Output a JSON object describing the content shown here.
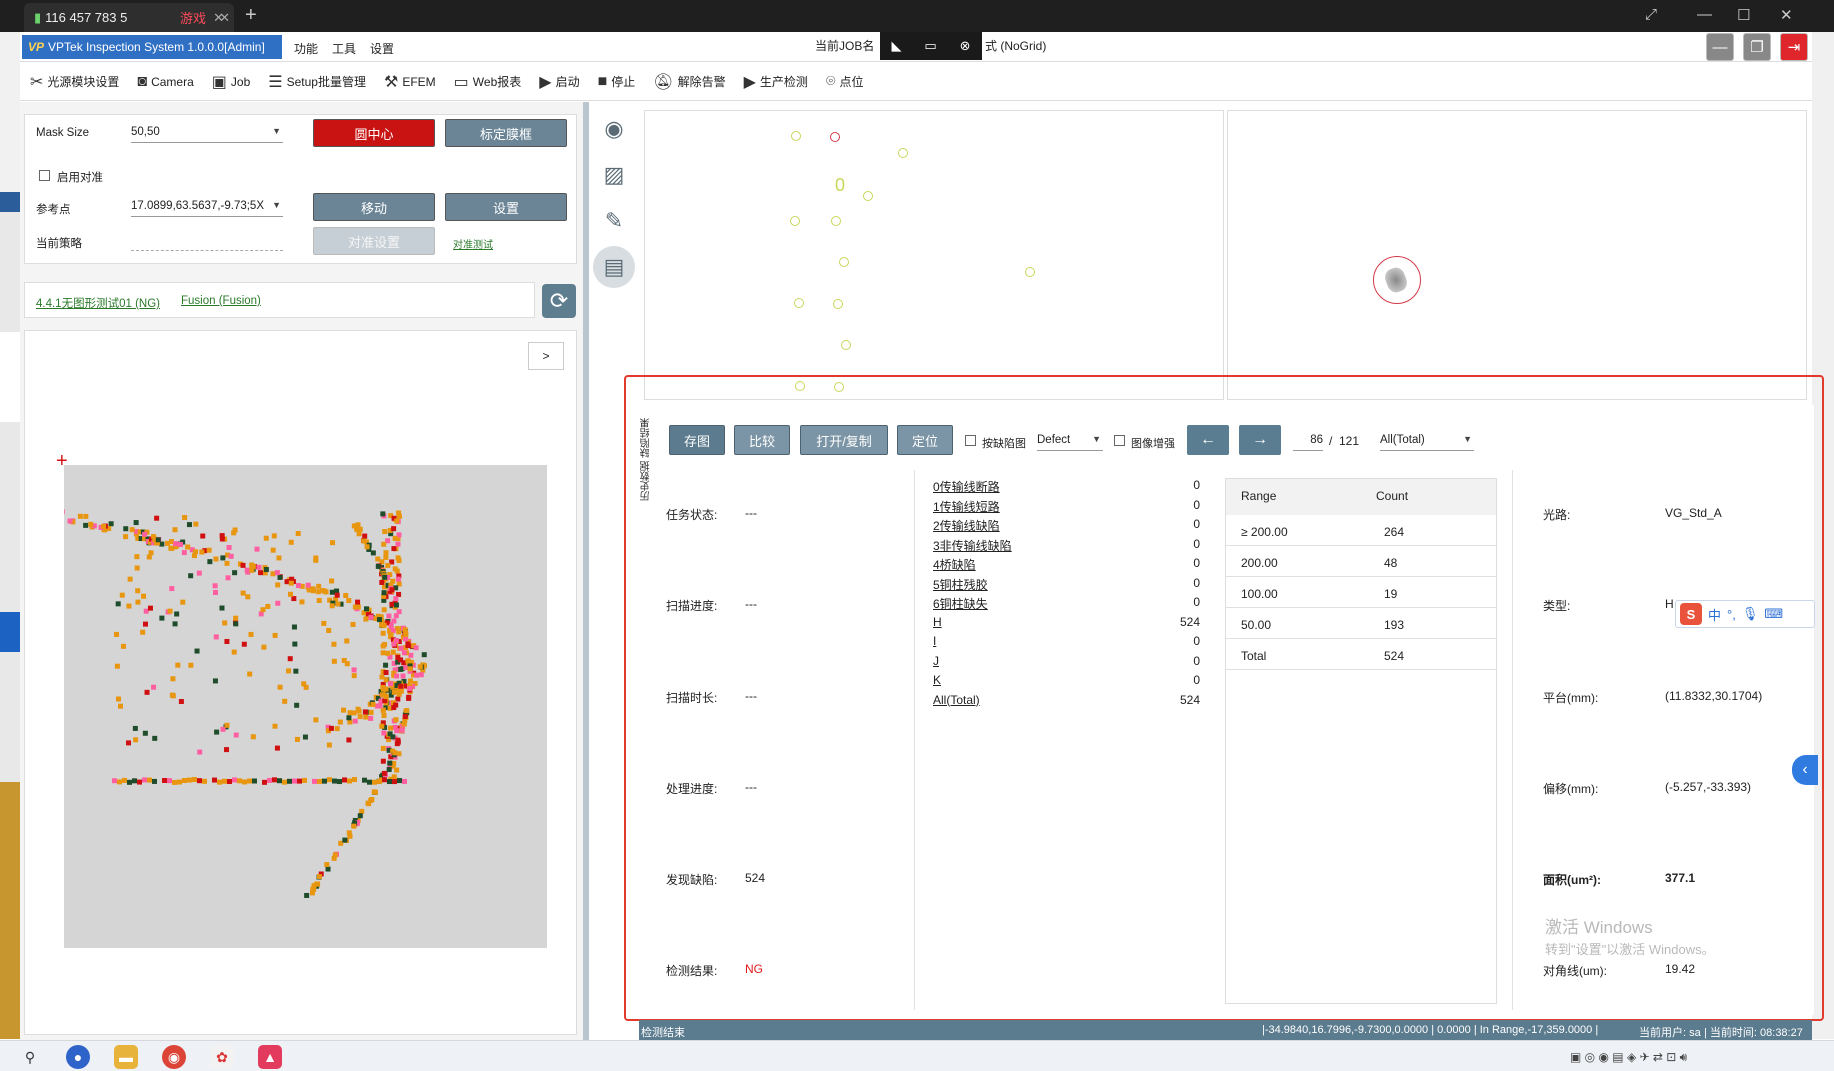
{
  "browser": {
    "tab1_title": "116 457 783 5",
    "tab2_title": "游戏",
    "close": "✕",
    "new_tab": "+"
  },
  "app": {
    "title": "VPTek Inspection System 1.0.0.0[Admin]",
    "logo": "VP",
    "menu": [
      "功能",
      "工具",
      "设置"
    ],
    "job_info_left": "当前JOB名",
    "job_info_right": "式 (NoGrid)"
  },
  "toolbar": {
    "items": [
      "光源模块设置",
      "Camera",
      "Job",
      "Setup批量管理",
      "EFEM",
      "Web报表",
      "启动",
      "停止",
      "解除告警",
      "生产检测",
      "点位"
    ]
  },
  "left": {
    "mask_size_label": "Mask Size",
    "mask_size_value": "50,50",
    "circle_center_btn": "圆中心",
    "calib_frame_btn": "标定膜框",
    "enable_align_label": "启用对准",
    "ref_point_label": "参考点",
    "ref_point_value": "17.0899,63.5637,-9.73;5X",
    "move_btn": "移动",
    "set_btn": "设置",
    "strategy_label": "当前策略",
    "align_setup_btn": "对准设置",
    "align_test_link": "对准测试",
    "recipe_link": "4.4.1无图形测试01 (NG)",
    "fusion_link": "Fusion (Fusion)",
    "expand_btn": ">"
  },
  "results": {
    "side_tabs": "历史数据  缺陷结果",
    "buttons": [
      "存图",
      "比较",
      "打开/复制",
      "定位"
    ],
    "by_defect_label": "按缺陷图",
    "defect_select": "Defect",
    "image_enhance_label": "图像增强",
    "prev_btn": "←",
    "next_btn": "→",
    "page_current": "86",
    "page_sep": "/",
    "page_total": "121",
    "filter_select": "All(Total)",
    "status": [
      {
        "label": "任务状态:",
        "value": "---"
      },
      {
        "label": "扫描进度:",
        "value": "---"
      },
      {
        "label": "扫描时长:",
        "value": "---"
      },
      {
        "label": "处理进度:",
        "value": "---"
      },
      {
        "label": "发现缺陷:",
        "value": "524"
      },
      {
        "label": "检测结果:",
        "value": "NG"
      }
    ],
    "defects": [
      {
        "name": "0传输线断路",
        "count": "0"
      },
      {
        "name": "1传输线短路",
        "count": "0"
      },
      {
        "name": "2传输线缺陷",
        "count": "0"
      },
      {
        "name": "3非传输线缺陷",
        "count": "0"
      },
      {
        "name": "4桥缺陷",
        "count": "0"
      },
      {
        "name": "5铜柱残胶",
        "count": "0"
      },
      {
        "name": "6铜柱缺失",
        "count": "0"
      },
      {
        "name": "H",
        "count": "524"
      },
      {
        "name": "I",
        "count": "0"
      },
      {
        "name": "J",
        "count": "0"
      },
      {
        "name": "K",
        "count": "0"
      },
      {
        "name": "All(Total)",
        "count": "524"
      }
    ],
    "range_header": {
      "range": "Range",
      "count": "Count"
    },
    "ranges": [
      {
        "range": "≥ 200.00",
        "count": "264"
      },
      {
        "range": "200.00",
        "count": "48"
      },
      {
        "range": "100.00",
        "count": "19"
      },
      {
        "range": "50.00",
        "count": "193"
      },
      {
        "range": "Total",
        "count": "524"
      }
    ],
    "info": [
      {
        "label": "光路:",
        "value": "VG_Std_A"
      },
      {
        "label": "类型:",
        "value": "H"
      },
      {
        "label": "平台(mm):",
        "value": "(11.8332,30.1704)"
      },
      {
        "label": "偏移(mm):",
        "value": "(-5.257,-33.393)"
      },
      {
        "label": "面积(um²):",
        "value": "377.1"
      },
      {
        "label": "对角线(um):",
        "value": "19.42"
      }
    ]
  },
  "statusbar": {
    "left": "检测结束",
    "coords": "|-34.9840,16.7996,-9.7300,0.0000  | 0.0000  | In Range,-17,359.0000  |",
    "user": "当前用户: sa",
    "time": "| 当前时间: 08:38:27"
  },
  "watermark": {
    "title": "激活 Windows",
    "sub": "转到\"设置\"以激活 Windows。"
  },
  "ime": {
    "logo": "S",
    "mode": "中"
  },
  "colors": {
    "accent": "#2f6fc4",
    "button": "#6b8596",
    "danger": "#c91313",
    "highlight_border": "#e23b2b",
    "ng": "#e01a1a"
  }
}
